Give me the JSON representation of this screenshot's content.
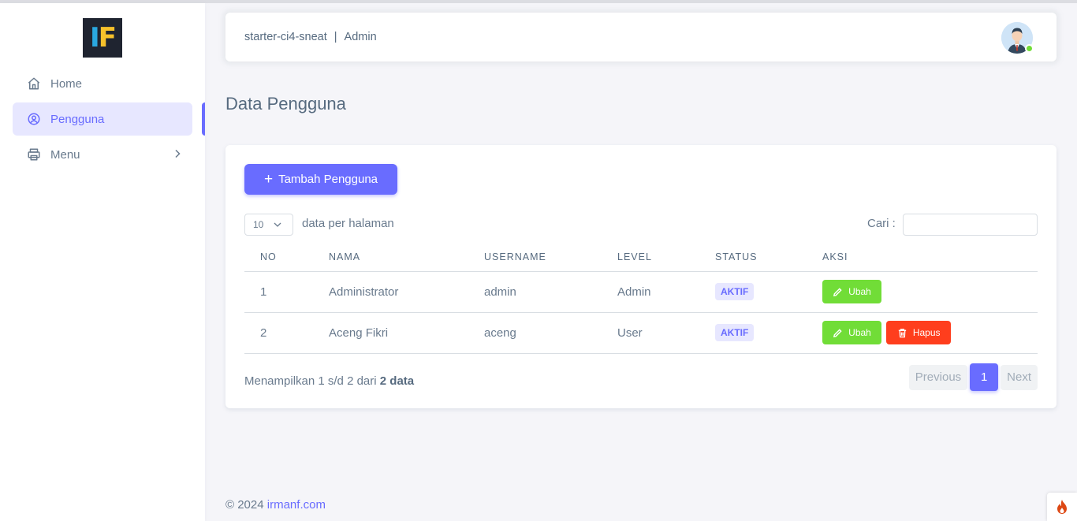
{
  "app": {
    "logo_text": "IF"
  },
  "sidebar": {
    "items": [
      {
        "label": "Home",
        "icon": "home-icon",
        "active": false
      },
      {
        "label": "Pengguna",
        "icon": "user-circle-icon",
        "active": true
      },
      {
        "label": "Menu",
        "icon": "printer-icon",
        "active": false,
        "has_submenu": true
      }
    ]
  },
  "topbar": {
    "app_name": "starter-ci4-sneat",
    "separator": "|",
    "role": "Admin",
    "avatar": "avatar",
    "online": true
  },
  "page": {
    "title": "Data Pengguna"
  },
  "toolbar": {
    "add_plus": "+",
    "add_label": "Tambah Pengguna",
    "perpage_value": "10",
    "perpage_label": "data per halaman",
    "search_label": "Cari :",
    "search_value": ""
  },
  "table": {
    "headers": [
      "NO",
      "NAMA",
      "USERNAME",
      "LEVEL",
      "STATUS",
      "AKSI"
    ],
    "rows": [
      {
        "no": "1",
        "nama": "Administrator",
        "username": "admin",
        "level": "Admin",
        "status": "AKTIF",
        "actions": [
          "Ubah"
        ]
      },
      {
        "no": "2",
        "nama": "Aceng Fikri",
        "username": "aceng",
        "level": "User",
        "status": "AKTIF",
        "actions": [
          "Ubah",
          "Hapus"
        ]
      }
    ]
  },
  "summary": {
    "prefix": "Menampilkan 1 s/d 2 dari",
    "total": "2 data"
  },
  "pagination": {
    "previous": "Previous",
    "current": "1",
    "next": "Next"
  },
  "footer": {
    "copyright": "© 2024",
    "link_text": "irmanf.com"
  },
  "colors": {
    "primary": "#696cff",
    "success": "#71dd37",
    "danger": "#ff3e1d",
    "background": "#f5f5f9"
  }
}
